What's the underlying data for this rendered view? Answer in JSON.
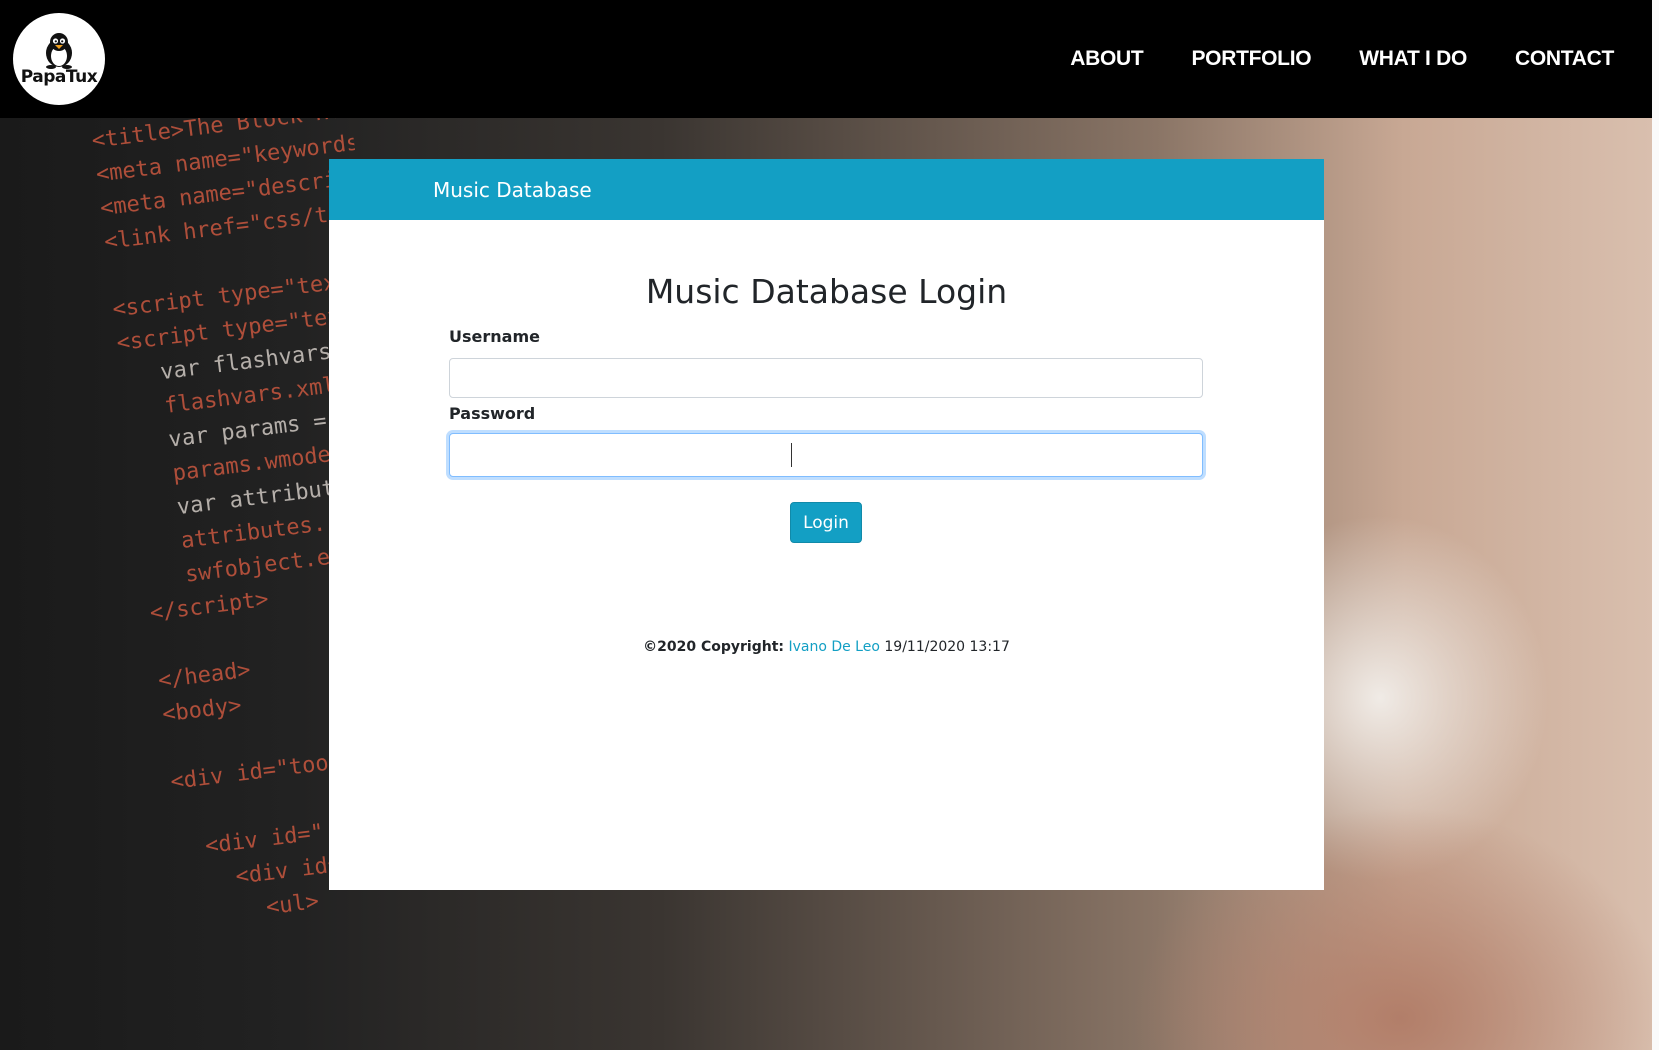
{
  "site": {
    "logo_text": "PapaTux",
    "nav": [
      "ABOUT",
      "PORTFOLIO",
      "WHAT I DO",
      "CONTACT"
    ]
  },
  "card": {
    "header_title": "Music Database",
    "title": "Music Database Login",
    "username_label": "Username",
    "username_value": "",
    "password_label": "Password",
    "password_value": "",
    "login_label": "Login"
  },
  "footer": {
    "copyright_label": "©2020 Copyright:",
    "author": "Ivano De Leo",
    "timestamp": "19/11/2020 13:17"
  },
  "colors": {
    "accent": "#139fc4",
    "nav_bg": "#000000"
  }
}
